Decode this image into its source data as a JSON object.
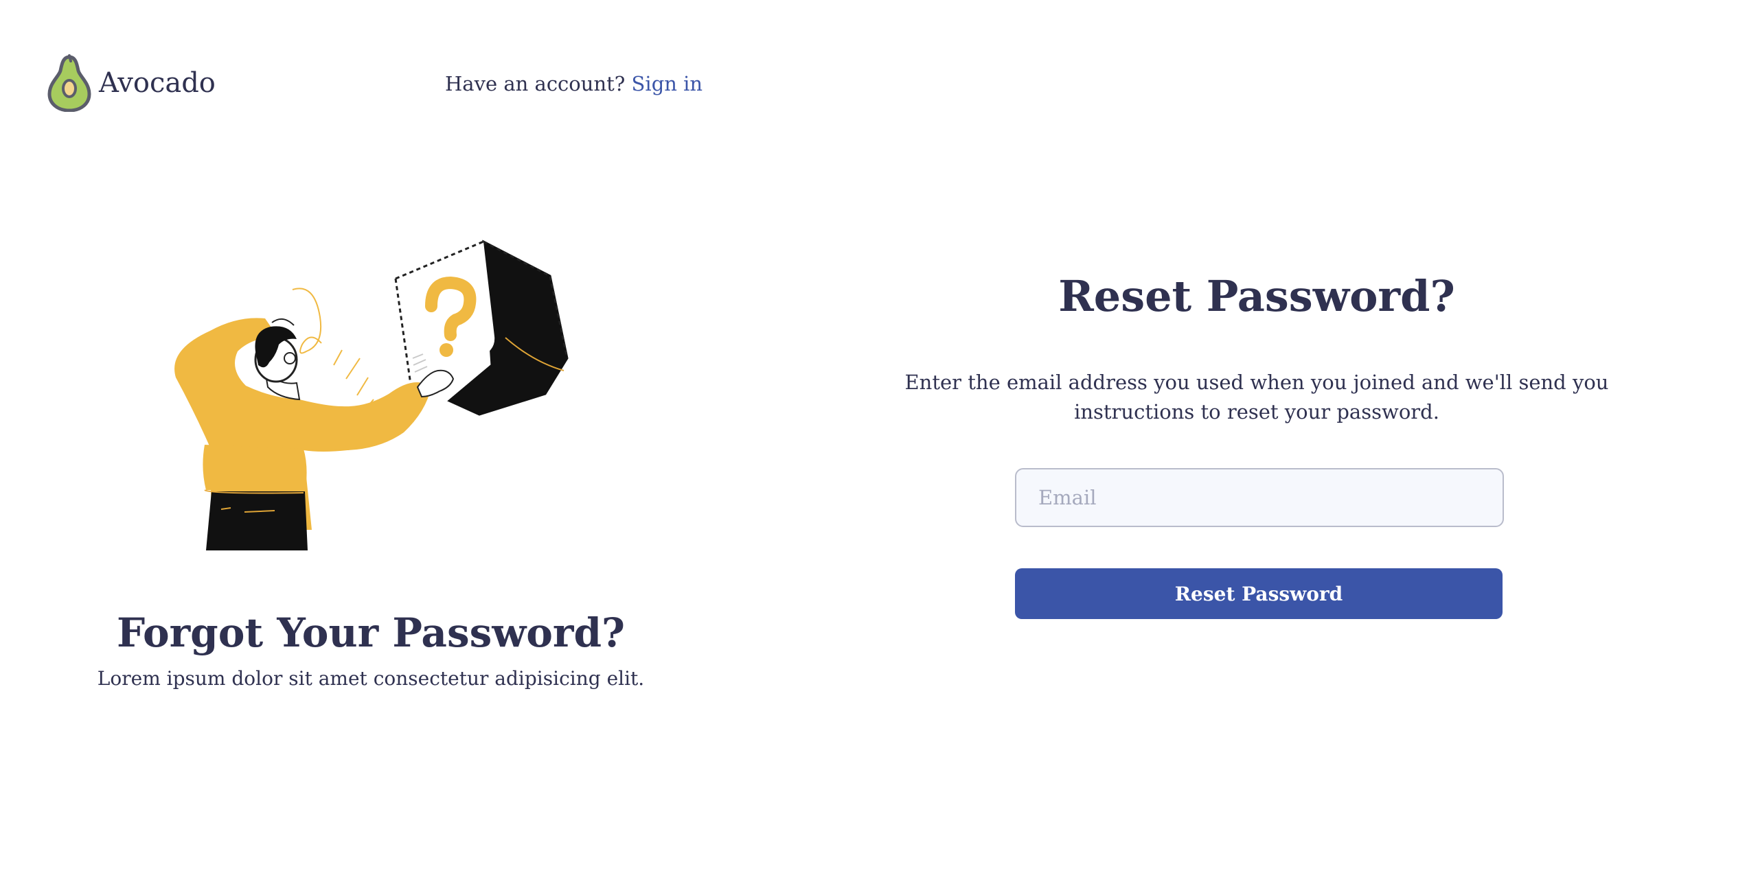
{
  "brand": {
    "name": "Avocado",
    "icon": "avocado-icon",
    "colors": {
      "skin": "#a7cc5e",
      "outline": "#5b5d6b",
      "pit": "#e3b95a"
    }
  },
  "header": {
    "prompt_text": "Have an account?",
    "signin_link": "Sign in"
  },
  "left_panel": {
    "illustration": "confused-person-question-box-illustration",
    "title": "Forgot Your Password?",
    "subtitle": "Lorem ipsum dolor sit amet consectetur adipisicing elit."
  },
  "form": {
    "title": "Reset Password?",
    "description_line1": "Enter the email address you used when you joined and we'll send you",
    "description_line2": "instructions to reset your password.",
    "email": {
      "placeholder": "Email",
      "value": ""
    },
    "submit_label": "Reset Password"
  },
  "colors": {
    "text": "#2f3150",
    "accent": "#3b55a8",
    "illustration_yellow": "#f0b942",
    "input_bg": "#f6f8fd",
    "input_border": "#b9bccb"
  }
}
